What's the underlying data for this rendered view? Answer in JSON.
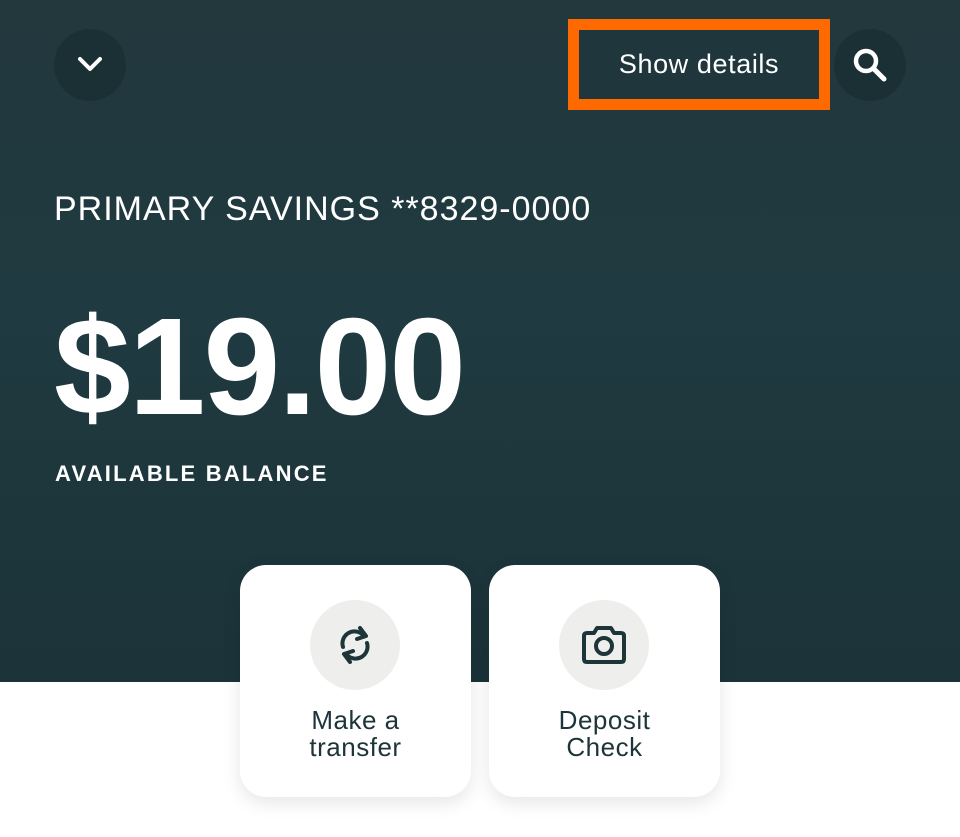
{
  "header": {
    "collapse_icon": "chevron-down-icon",
    "details_button_label": "Show details",
    "search_icon": "search-icon"
  },
  "account": {
    "name": "PRIMARY SAVINGS **8329-0000",
    "balance": "$19.00",
    "balance_label": "AVAILABLE BALANCE"
  },
  "actions": [
    {
      "icon": "sync-icon",
      "label_line1": "Make a",
      "label_line2": "transfer"
    },
    {
      "icon": "camera-icon",
      "label_line1": "Deposit",
      "label_line2": "Check"
    }
  ],
  "colors": {
    "header_background": "#1f3a40",
    "highlight": "#ff6a00",
    "text_dark": "#1d3439",
    "icon_circle": "#eeefec"
  }
}
